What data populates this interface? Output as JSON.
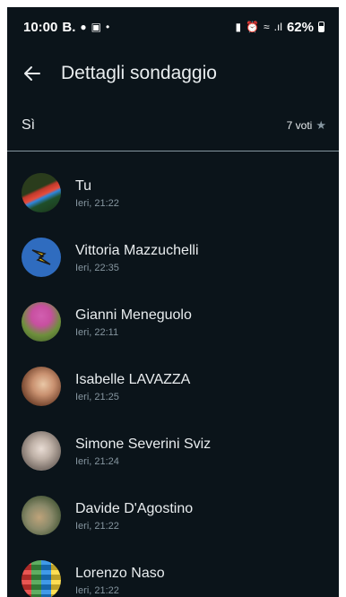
{
  "status_bar": {
    "time": "10:00",
    "left_badge": "B.",
    "battery": "62%"
  },
  "header": {
    "title": "Dettagli sondaggio"
  },
  "option": {
    "label": "Sì",
    "votes": "7 voti"
  },
  "voters": [
    {
      "name": "Tu",
      "time": "Ieri, 21:22"
    },
    {
      "name": "Vittoria Mazzuchelli",
      "time": "Ieri, 22:35"
    },
    {
      "name": "Gianni Meneguolo",
      "time": "Ieri, 22:11"
    },
    {
      "name": "Isabelle LAVAZZA",
      "time": "Ieri, 21:25"
    },
    {
      "name": "Simone Severini Sviz",
      "time": "Ieri, 21:24"
    },
    {
      "name": "Davide D'Agostino",
      "time": "Ieri, 21:22"
    },
    {
      "name": "Lorenzo Naso",
      "time": "Ieri, 21:22"
    }
  ]
}
